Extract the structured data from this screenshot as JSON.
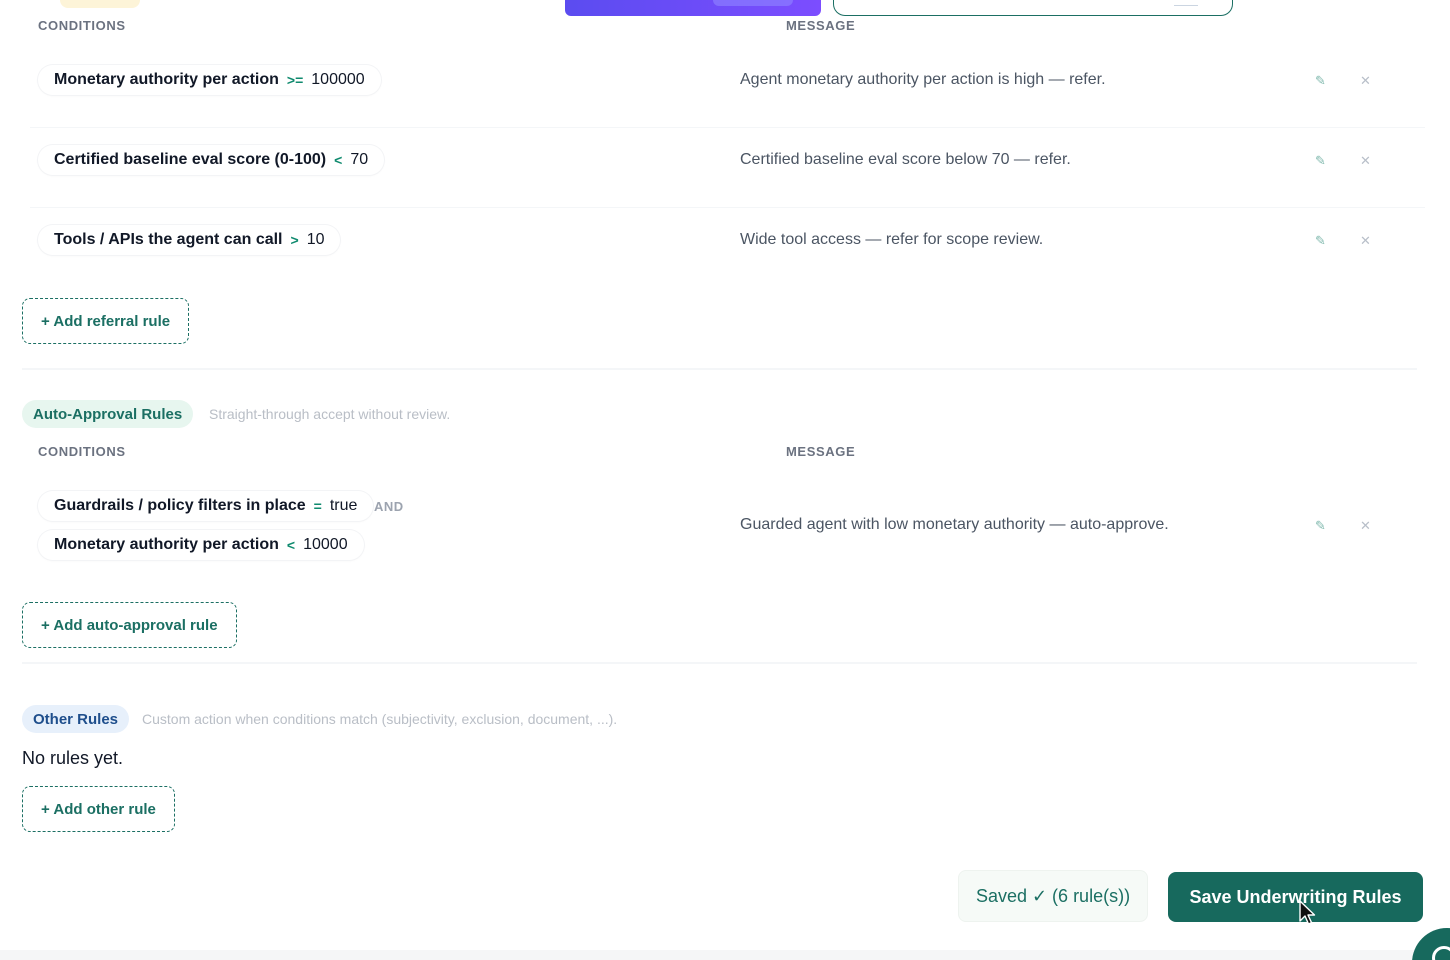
{
  "referral_section": {
    "conditions_header": "CONDITIONS",
    "message_header": "MESSAGE",
    "rules": [
      {
        "conditions": [
          {
            "field": "Monetary authority per action",
            "op": ">=",
            "value": "100000"
          }
        ],
        "message": "Agent monetary authority per action is high — refer."
      },
      {
        "conditions": [
          {
            "field": "Certified baseline eval score (0-100)",
            "op": "<",
            "value": "70"
          }
        ],
        "message": "Certified baseline eval score below 70 — refer."
      },
      {
        "conditions": [
          {
            "field": "Tools / APIs the agent can call",
            "op": ">",
            "value": "10"
          }
        ],
        "message": "Wide tool access — refer for scope review."
      }
    ],
    "add_label": "+ Add referral rule"
  },
  "auto_approval_section": {
    "badge": "Auto-Approval Rules",
    "description": "Straight-through accept without review.",
    "conditions_header": "CONDITIONS",
    "message_header": "MESSAGE",
    "rules": [
      {
        "conditions": [
          {
            "field": "Guardrails / policy filters in place",
            "op": "=",
            "value": "true"
          },
          {
            "field": "Monetary authority per action",
            "op": "<",
            "value": "10000"
          }
        ],
        "joiner": "AND",
        "message": "Guarded agent with low monetary authority — auto-approve."
      }
    ],
    "add_label": "+ Add auto-approval rule"
  },
  "other_section": {
    "badge": "Other Rules",
    "description": "Custom action when conditions match (subjectivity, exclusion, document, ...).",
    "empty_text": "No rules yet.",
    "add_label": "+ Add other rule"
  },
  "footer": {
    "saved_status": "Saved ✓ (6 rule(s))",
    "save_button": "Save Underwriting Rules"
  },
  "icons": {
    "edit": "✎",
    "delete": "✕"
  },
  "colors": {
    "accent": "#17695d",
    "operator": "#0f8a6e",
    "green_badge_bg": "#e7f6ef",
    "blue_badge_bg": "#e7f0fb",
    "purple": "#5b4cf0"
  }
}
